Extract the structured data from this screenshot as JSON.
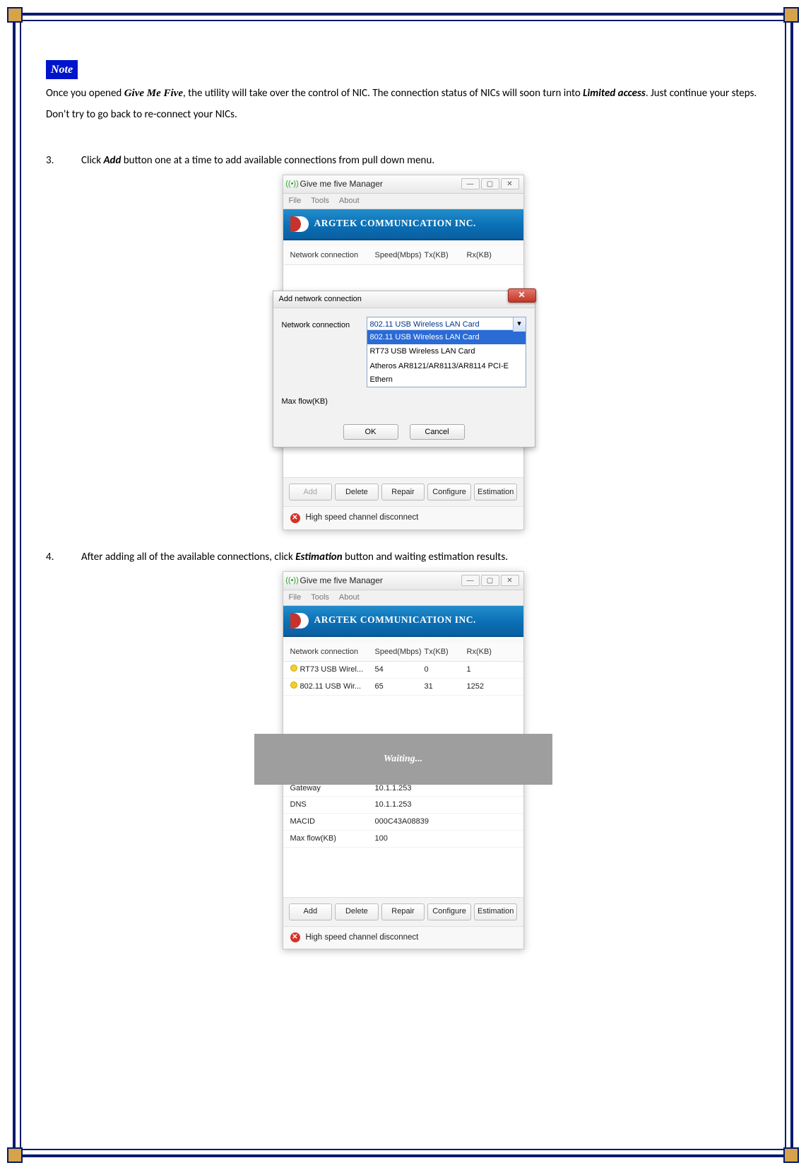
{
  "note": {
    "badge": "Note",
    "text_a": "Once you opened ",
    "app": "Give Me Five",
    "text_b": ", the utility will take over the control of NIC. The connection status of NICs will soon turn into ",
    "limited": "Limited access",
    "text_c": ". Just continue your steps. Don't try to go back to re-connect your NICs."
  },
  "step3": {
    "num": "3.",
    "a": "Click ",
    "add": "Add",
    "b": " button one at a time to add available connections from pull down menu."
  },
  "step4": {
    "num": "4.",
    "a": "After adding all of the available connections, click ",
    "est": "Estimation",
    "b": " button and waiting estimation results."
  },
  "win": {
    "title": "Give me five Manager",
    "menu": {
      "file": "File",
      "tools": "Tools",
      "about": "About"
    },
    "banner": "ARGTEK COMMUNICATION INC.",
    "icons": {
      "min": "—",
      "max": "▢",
      "close": "✕"
    },
    "cols": {
      "c1": "Network connection",
      "c2": "Speed(Mbps)",
      "c3": "Tx(KB)",
      "c4": "Rx(KB)"
    },
    "btns": {
      "add": "Add",
      "delete": "Delete",
      "repair": "Repair",
      "configure": "Configure",
      "estimation": "Estimation"
    },
    "status": "High speed channel disconnect",
    "status_x": "✕"
  },
  "dlg": {
    "title": "Add network connection",
    "lbl_net": "Network connection",
    "lbl_max": "Max flow(KB)",
    "selected": "802.11 USB Wireless LAN Card",
    "opts": [
      "802.11 USB Wireless LAN Card",
      "RT73 USB Wireless LAN Card",
      "Atheros AR8121/AR8113/AR8114 PCI-E Ethern"
    ],
    "arrow": "▾",
    "ok": "OK",
    "cancel": "Cancel",
    "close": "✕"
  },
  "fig2": {
    "rows": [
      {
        "name": "RT73 USB Wirel...",
        "speed": "54",
        "tx": "0",
        "rx": "1"
      },
      {
        "name": "802.11 USB Wir...",
        "speed": "65",
        "tx": "31",
        "rx": "1252"
      }
    ],
    "waiting": "Waiting...",
    "info": [
      {
        "k": "Gateway",
        "v": "10.1.1.253"
      },
      {
        "k": "DNS",
        "v": "10.1.1.253"
      },
      {
        "k": "MACID",
        "v": "000C43A08839"
      },
      {
        "k": "Max flow(KB)",
        "v": "100"
      }
    ]
  }
}
